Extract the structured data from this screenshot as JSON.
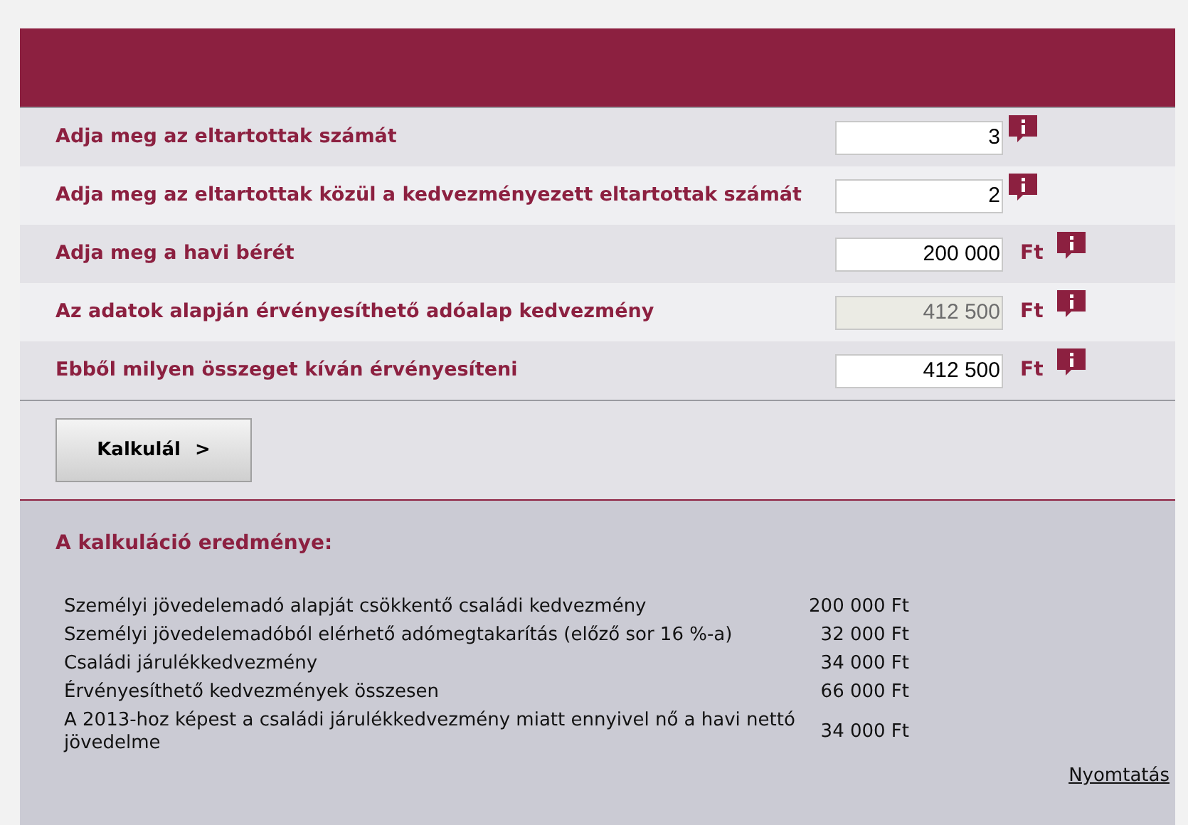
{
  "fields": [
    {
      "label": "Adja meg az eltartottak számát",
      "value": "3",
      "disabled": false
    },
    {
      "label": "Adja meg az eltartottak közül a kedvezményezett eltartottak számát",
      "value": "2",
      "disabled": false
    },
    {
      "label": "Adja meg a havi bérét",
      "value": "200 000",
      "unit": "Ft",
      "disabled": false
    },
    {
      "label": "Az adatok alapján érvényesíthető adóalap kedvezmény",
      "value": "412 500",
      "unit": "Ft",
      "disabled": true
    },
    {
      "label": "Ebből milyen összeget kíván érvényesíteni",
      "value": "412 500",
      "unit": "Ft",
      "disabled": false
    }
  ],
  "button": {
    "label": "Kalkulál",
    "arrow": ">"
  },
  "results": {
    "title": "A kalkuláció eredménye:",
    "rows": [
      {
        "label": "Személyi jövedelemadó alapját csökkentő családi kedvezmény",
        "value": "200 000 Ft"
      },
      {
        "label": "Személyi jövedelemadóból elérhető adómegtakarítás (előző sor 16 %-a)",
        "value": "32 000 Ft"
      },
      {
        "label": "Családi járulékkedvezmény",
        "value": "34 000 Ft"
      },
      {
        "label": "Érvényesíthető kedvezmények összesen",
        "value": "66 000 Ft"
      },
      {
        "label": "A 2013-hoz képest a családi járulékkedvezmény miatt ennyivel nő a havi nettó jövedelme",
        "value": "34 000 Ft"
      }
    ],
    "print_link": "Nyomtatás"
  }
}
